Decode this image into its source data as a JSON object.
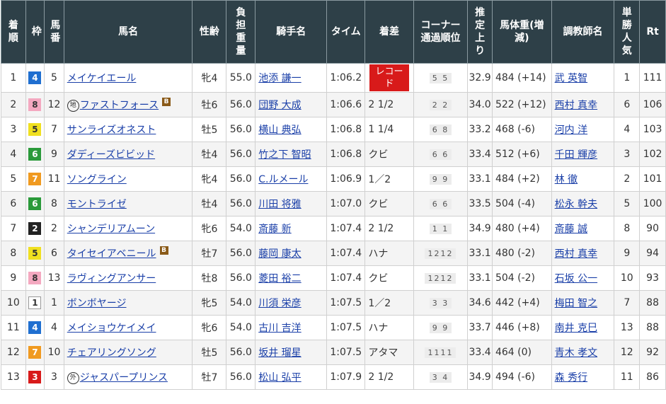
{
  "headers": [
    {
      "id": "place",
      "label": "着順"
    },
    {
      "id": "waku",
      "label": "枠"
    },
    {
      "id": "num",
      "label": "馬番"
    },
    {
      "id": "name",
      "label": "馬名"
    },
    {
      "id": "sexage",
      "label": "性齢"
    },
    {
      "id": "weight",
      "label": "負担重量"
    },
    {
      "id": "jockey",
      "label": "騎手名"
    },
    {
      "id": "time",
      "label": "タイム"
    },
    {
      "id": "margin",
      "label": "着差"
    },
    {
      "id": "corner",
      "label": "コーナー通過順位"
    },
    {
      "id": "last3f",
      "label": "推定上り"
    },
    {
      "id": "body",
      "label": "馬体重(増減)"
    },
    {
      "id": "trainer",
      "label": "調教師名"
    },
    {
      "id": "pop",
      "label": "単勝人気"
    },
    {
      "id": "rt",
      "label": "Rt"
    }
  ],
  "waku_colors": {
    "1": {
      "bg": "#ffffff",
      "fg": "#333333",
      "border": "#999999"
    },
    "2": {
      "bg": "#222222",
      "fg": "#ffffff",
      "border": "#222222"
    },
    "3": {
      "bg": "#d81a1a",
      "fg": "#ffffff",
      "border": "#d81a1a"
    },
    "4": {
      "bg": "#1f6fd0",
      "fg": "#ffffff",
      "border": "#1f6fd0"
    },
    "5": {
      "bg": "#f0e020",
      "fg": "#333333",
      "border": "#f0e020"
    },
    "6": {
      "bg": "#2a9a3a",
      "fg": "#ffffff",
      "border": "#2a9a3a"
    },
    "7": {
      "bg": "#f09a20",
      "fg": "#ffffff",
      "border": "#f09a20"
    },
    "8": {
      "bg": "#f4a8c0",
      "fg": "#333333",
      "border": "#f4a8c0"
    }
  },
  "rows": [
    {
      "place": "1",
      "waku": "4",
      "num": "5",
      "mark": "",
      "name": "メイケイエール",
      "blinker": false,
      "sexage": "牝4",
      "weight": "55.0",
      "jockey": "池添 謙一",
      "time": "1:06.2",
      "margin": "",
      "record": "レコード",
      "corner": "5 5",
      "last3f": "32.9",
      "body": "484 (+14)",
      "trainer": "武 英智",
      "pop": "1",
      "rt": "111"
    },
    {
      "place": "2",
      "waku": "8",
      "num": "12",
      "mark": "地",
      "name": "ファストフォース",
      "blinker": true,
      "sexage": "牡6",
      "weight": "56.0",
      "jockey": "団野 大成",
      "time": "1:06.6",
      "margin": "2 1/2",
      "record": "",
      "corner": "2 2",
      "last3f": "34.0",
      "body": "522 (+12)",
      "trainer": "西村 真幸",
      "pop": "6",
      "rt": "106"
    },
    {
      "place": "3",
      "waku": "5",
      "num": "7",
      "mark": "",
      "name": "サンライズオネスト",
      "blinker": false,
      "sexage": "牡5",
      "weight": "56.0",
      "jockey": "横山 典弘",
      "time": "1:06.8",
      "margin": "1 1/4",
      "record": "",
      "corner": "6 8",
      "last3f": "33.2",
      "body": "468 (-6)",
      "trainer": "河内 洋",
      "pop": "4",
      "rt": "103"
    },
    {
      "place": "4",
      "waku": "6",
      "num": "9",
      "mark": "",
      "name": "ダディーズビビッド",
      "blinker": false,
      "sexage": "牡4",
      "weight": "56.0",
      "jockey": "竹之下 智昭",
      "time": "1:06.8",
      "margin": "クビ",
      "record": "",
      "corner": "6 6",
      "last3f": "33.4",
      "body": "512 (+6)",
      "trainer": "千田 輝彦",
      "pop": "3",
      "rt": "102"
    },
    {
      "place": "5",
      "waku": "7",
      "num": "11",
      "mark": "",
      "name": "ソングライン",
      "blinker": false,
      "sexage": "牝4",
      "weight": "56.0",
      "jockey": "C.ルメール",
      "time": "1:06.9",
      "margin": "1／2",
      "record": "",
      "corner": "9 9",
      "last3f": "33.1",
      "body": "484 (+2)",
      "trainer": "林 徹",
      "pop": "2",
      "rt": "101"
    },
    {
      "place": "6",
      "waku": "6",
      "num": "8",
      "mark": "",
      "name": "モントライゼ",
      "blinker": false,
      "sexage": "牡4",
      "weight": "56.0",
      "jockey": "川田 将雅",
      "time": "1:07.0",
      "margin": "クビ",
      "record": "",
      "corner": "6 6",
      "last3f": "33.5",
      "body": "504 (-4)",
      "trainer": "松永 幹夫",
      "pop": "5",
      "rt": "100"
    },
    {
      "place": "7",
      "waku": "2",
      "num": "2",
      "mark": "",
      "name": "シャンデリアムーン",
      "blinker": false,
      "sexage": "牝6",
      "weight": "54.0",
      "jockey": "斎藤 新",
      "time": "1:07.4",
      "margin": "2 1/2",
      "record": "",
      "corner": "1 1",
      "last3f": "34.9",
      "body": "480 (+4)",
      "trainer": "斎藤 誠",
      "pop": "8",
      "rt": "90"
    },
    {
      "place": "8",
      "waku": "5",
      "num": "6",
      "mark": "",
      "name": "タイセイアベニール",
      "blinker": true,
      "sexage": "牡7",
      "weight": "56.0",
      "jockey": "藤岡 康太",
      "time": "1:07.4",
      "margin": "ハナ",
      "record": "",
      "corner": "1212",
      "last3f": "33.1",
      "body": "480 (-2)",
      "trainer": "西村 真幸",
      "pop": "9",
      "rt": "94"
    },
    {
      "place": "9",
      "waku": "8",
      "num": "13",
      "mark": "",
      "name": "ラヴィングアンサー",
      "blinker": false,
      "sexage": "牡8",
      "weight": "56.0",
      "jockey": "菱田 裕二",
      "time": "1:07.4",
      "margin": "クビ",
      "record": "",
      "corner": "1212",
      "last3f": "33.1",
      "body": "504 (-2)",
      "trainer": "石坂 公一",
      "pop": "10",
      "rt": "93"
    },
    {
      "place": "10",
      "waku": "1",
      "num": "1",
      "mark": "",
      "name": "ボンボヤージ",
      "blinker": false,
      "sexage": "牝5",
      "weight": "54.0",
      "jockey": "川須 栄彦",
      "time": "1:07.5",
      "margin": "1／2",
      "record": "",
      "corner": "3 3",
      "last3f": "34.6",
      "body": "442 (+4)",
      "trainer": "梅田 智之",
      "pop": "7",
      "rt": "88"
    },
    {
      "place": "11",
      "waku": "4",
      "num": "4",
      "mark": "",
      "name": "メイショウケイメイ",
      "blinker": false,
      "sexage": "牝6",
      "weight": "54.0",
      "jockey": "古川 吉洋",
      "time": "1:07.5",
      "margin": "ハナ",
      "record": "",
      "corner": "9 9",
      "last3f": "33.7",
      "body": "446 (+8)",
      "trainer": "南井 克巳",
      "pop": "13",
      "rt": "88"
    },
    {
      "place": "12",
      "waku": "7",
      "num": "10",
      "mark": "",
      "name": "チェアリングソング",
      "blinker": false,
      "sexage": "牡5",
      "weight": "56.0",
      "jockey": "坂井 瑠星",
      "time": "1:07.5",
      "margin": "アタマ",
      "record": "",
      "corner": "1111",
      "last3f": "33.4",
      "body": "464 (0)",
      "trainer": "青木 孝文",
      "pop": "12",
      "rt": "92"
    },
    {
      "place": "13",
      "waku": "3",
      "num": "3",
      "mark": "外",
      "name": "ジャスパープリンス",
      "blinker": false,
      "sexage": "牡7",
      "weight": "56.0",
      "jockey": "松山 弘平",
      "time": "1:07.9",
      "margin": "2 1/2",
      "record": "",
      "corner": "3 4",
      "last3f": "34.9",
      "body": "494 (-6)",
      "trainer": "森 秀行",
      "pop": "11",
      "rt": "86"
    }
  ]
}
